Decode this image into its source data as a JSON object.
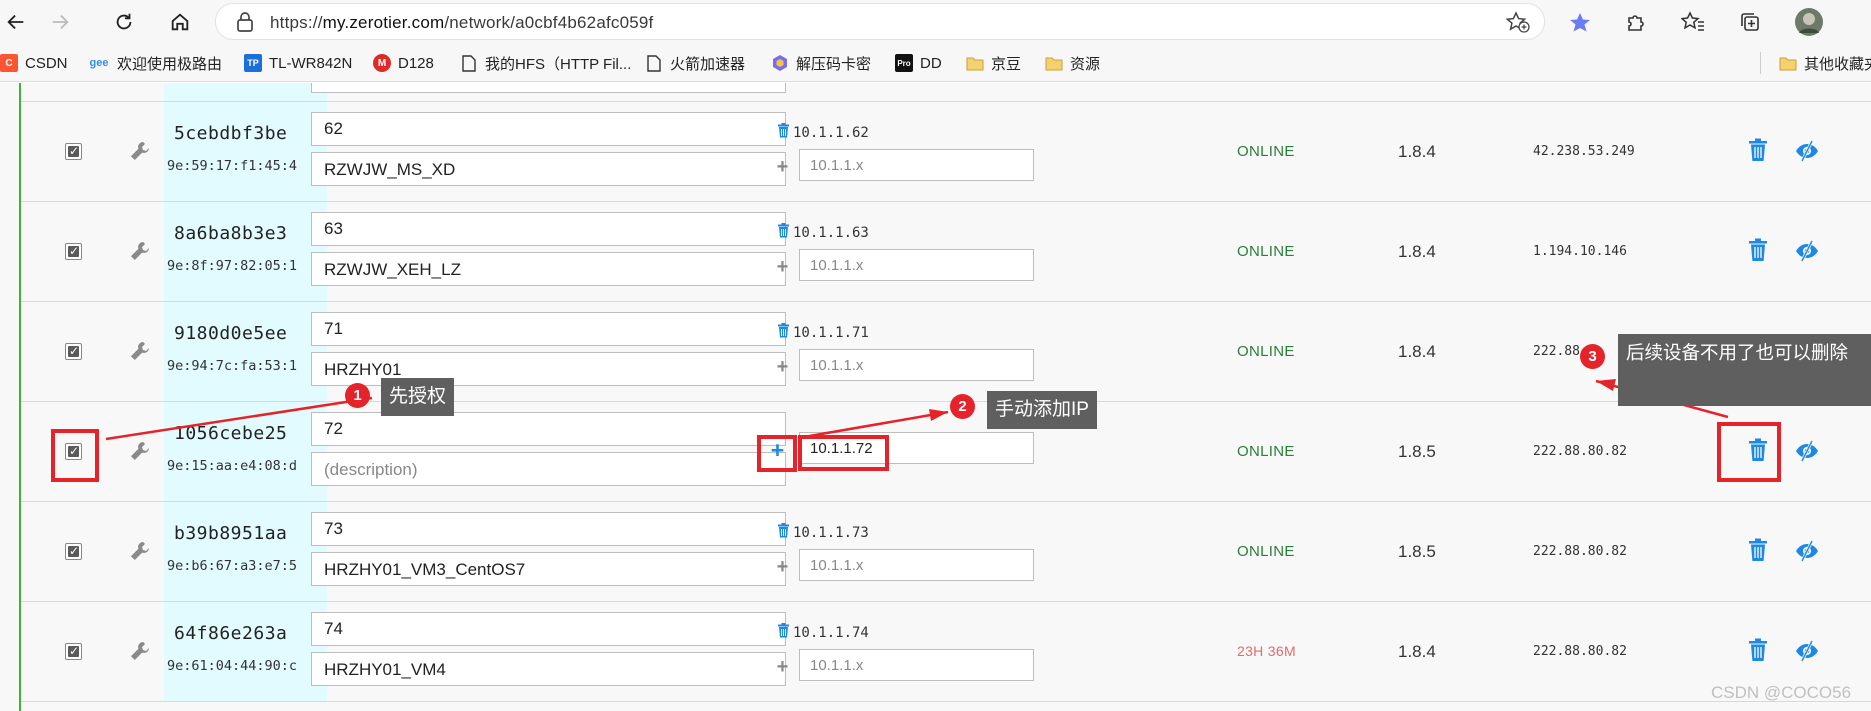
{
  "browser": {
    "url_prefix": "https://",
    "url_host": "my.zerotier.com",
    "url_path": "/network/a0cbf4b62afc059f"
  },
  "bookmarks": [
    {
      "label": "CSDN",
      "icon": "csdn-icon",
      "color": "#fc5531"
    },
    {
      "label": "欢迎使用极路由",
      "icon": "geek-router-icon",
      "color": "#2f8fe8"
    },
    {
      "label": "TL-WR842N",
      "icon": "tplink-icon",
      "color": "#1c6fdb"
    },
    {
      "label": "D128",
      "icon": "m-icon",
      "color": "#e02a2a"
    },
    {
      "label": "我的HFS（HTTP Fil...",
      "icon": "page-icon",
      "color": "#333333"
    },
    {
      "label": "火箭加速器",
      "icon": "page-icon",
      "color": "#333333"
    },
    {
      "label": "解压码卡密",
      "icon": "hex-icon",
      "color": "#7a6cf0"
    },
    {
      "label": "DD",
      "icon": "pro-icon",
      "color": "#111111"
    },
    {
      "label": "京豆",
      "icon": "folder-icon",
      "color": "#e8b93a"
    },
    {
      "label": "资源",
      "icon": "folder-icon",
      "color": "#e8b93a"
    }
  ],
  "other_bookmarks": "其他收藏夹",
  "members": [
    {
      "node_id": "5cebdbf3be",
      "mac": "9e:59:17:f1:45:4",
      "name": "62",
      "description": "RZWJW_MS_XD",
      "ip": "10.1.1.62",
      "ip_placeholder": "10.1.1.x",
      "status": "ONLINE",
      "version": "1.8.4",
      "physical_ip": "42.238.53.249"
    },
    {
      "node_id": "8a6ba8b3e3",
      "mac": "9e:8f:97:82:05:1",
      "name": "63",
      "description": "RZWJW_XEH_LZ",
      "ip": "10.1.1.63",
      "ip_placeholder": "10.1.1.x",
      "status": "ONLINE",
      "version": "1.8.4",
      "physical_ip": "1.194.10.146"
    },
    {
      "node_id": "9180d0e5ee",
      "mac": "9e:94:7c:fa:53:1",
      "name": "71",
      "description": "HRZHY01",
      "ip": "10.1.1.71",
      "ip_placeholder": "10.1.1.x",
      "status": "ONLINE",
      "version": "1.8.4",
      "physical_ip": "222.88"
    },
    {
      "node_id": "1056cebe25",
      "mac": "9e:15:aa:e4:08:d",
      "name": "72",
      "description": "",
      "description_placeholder": "(description)",
      "ip": "",
      "ip_input_value": "10.1.1.72",
      "status": "ONLINE",
      "version": "1.8.5",
      "physical_ip": "222.88.80.82"
    },
    {
      "node_id": "b39b8951aa",
      "mac": "9e:b6:67:a3:e7:5",
      "name": "73",
      "description": "HRZHY01_VM3_CentOS7",
      "ip": "10.1.1.73",
      "ip_placeholder": "10.1.1.x",
      "status": "ONLINE",
      "version": "1.8.5",
      "physical_ip": "222.88.80.82"
    },
    {
      "node_id": "64f86e263a",
      "mac": "9e:61:04:44:90:c",
      "name": "74",
      "description": "HRZHY01_VM4",
      "ip": "10.1.1.74",
      "ip_placeholder": "10.1.1.x",
      "status": "23H 36M",
      "version": "1.8.4",
      "physical_ip": "222.88.80.82"
    }
  ],
  "annotations": [
    {
      "number": "1",
      "text": "先授权"
    },
    {
      "number": "2",
      "text": "手动添加IP"
    },
    {
      "number": "3",
      "text": "后续设备不用了也可以删除"
    }
  ],
  "watermark": "CSDN @COCO56",
  "colors": {
    "online": "#2a7f3a",
    "offline": "#e06c6c",
    "accent": "#1e88e5",
    "annotation": "#e5232a",
    "left_border": "#3cb43c"
  }
}
